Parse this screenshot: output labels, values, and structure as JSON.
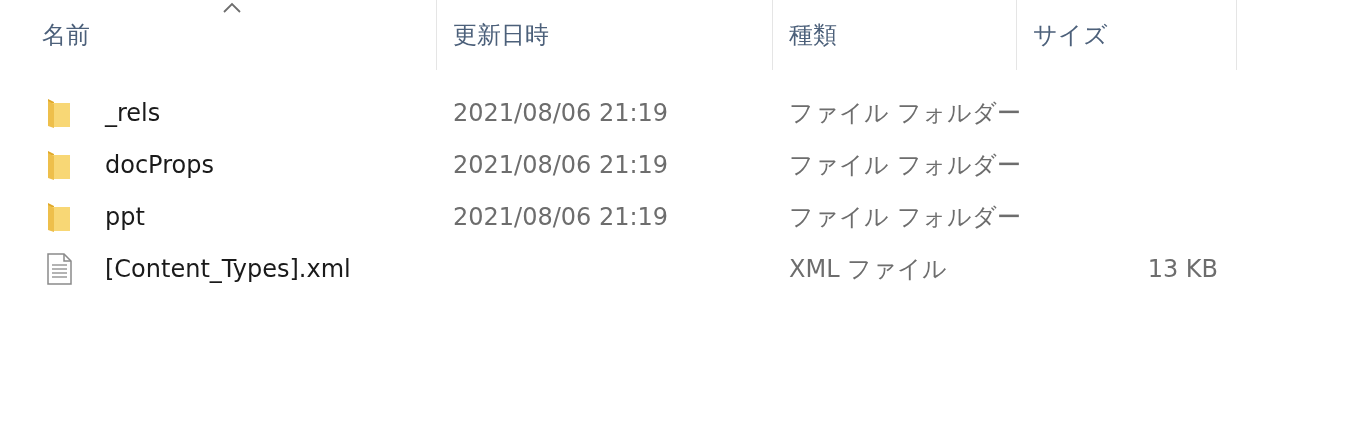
{
  "columns": [
    {
      "label": "名前",
      "sorted": true
    },
    {
      "label": "更新日時",
      "sorted": false
    },
    {
      "label": "種類",
      "sorted": false
    },
    {
      "label": "サイズ",
      "sorted": false
    }
  ],
  "rows": [
    {
      "kind": "folder",
      "name": "_rels",
      "modified": "2021/08/06 21:19",
      "type": "ファイル フォルダー"
    },
    {
      "kind": "folder",
      "name": "docProps",
      "modified": "2021/08/06 21:19",
      "type": "ファイル フォルダー"
    },
    {
      "kind": "folder",
      "name": "ppt",
      "modified": "2021/08/06 21:19",
      "type": "ファイル フォルダー"
    },
    {
      "kind": "file",
      "name": "[Content_Types].xml",
      "type": "XML ファイル",
      "size": "13 KB"
    }
  ]
}
